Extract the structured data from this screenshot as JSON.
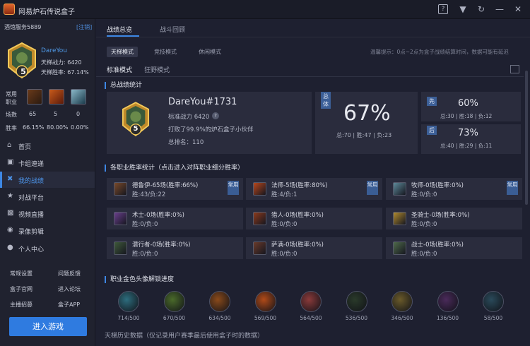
{
  "app": {
    "title": "网易炉石传说盒子"
  },
  "sidebar": {
    "server": "酒馆服务5889",
    "logout": "[注销]",
    "level": "5",
    "username": "DareYou",
    "ladder_power": "天梯战力: 6420",
    "ladder_winrate": "天梯胜率: 67.14%",
    "common_class_label": "常用职业",
    "stats": {
      "games_label": "场数",
      "games": [
        "65",
        "5",
        "0"
      ],
      "winrate_label": "胜率",
      "winrates": [
        "66.15%",
        "80.00%",
        "0.00%"
      ]
    },
    "nav": [
      {
        "icon": "home-icon",
        "label": "首页"
      },
      {
        "icon": "deck-icon",
        "label": "卡组速递"
      },
      {
        "icon": "swords-icon",
        "label": "我的战绩"
      },
      {
        "icon": "trophy-icon",
        "label": "对战平台"
      },
      {
        "icon": "tv-icon",
        "label": "视频直播"
      },
      {
        "icon": "film-icon",
        "label": "录像剪辑"
      },
      {
        "icon": "user-icon",
        "label": "个人中心"
      }
    ],
    "links": [
      "常规设置",
      "问题反馈",
      "盒子官网",
      "进入论坛",
      "主播招募",
      "盒子APP"
    ],
    "enter_game": "进入游戏"
  },
  "tabs": [
    "战绩总览",
    "战斗回顾"
  ],
  "modes": [
    "天梯模式",
    "竞技模式",
    "休闲模式"
  ],
  "hint": "温馨提示：0点~2点为盒子战绩结算时间，数据可能有延迟",
  "subtabs": [
    "标准模式",
    "狂野模式"
  ],
  "summary": {
    "section_title": "总战绩统计",
    "player_name": "DareYou#1731",
    "power": "标准战力 6420",
    "help": "?",
    "beat": "打败了99.9%的炉石盒子小伙伴",
    "rank": "总排名：110",
    "overall_tag": "总体",
    "overall_rate": "67%",
    "overall_detail": "总:70  |  胜:47  |  负:23",
    "first": {
      "tag": "先",
      "rate": "60%",
      "detail": "总:30  |  胜:18  |  负:12"
    },
    "second": {
      "tag": "后",
      "rate": "73%",
      "detail": "总:40  |  胜:29  |  负:11"
    }
  },
  "classes_title": "各职业胜率统计（点击进入对阵职业细分胜率）",
  "classes": [
    {
      "name": "德鲁伊-65场(胜率:66%)",
      "detail": "胜:43/负:22",
      "common": "常用",
      "icon": "druid-icon",
      "color": "#7a4a2a"
    },
    {
      "name": "法师-5场(胜率:80%)",
      "detail": "胜:4/负:1",
      "common": "常用",
      "icon": "mage-icon",
      "color": "#b8471c"
    },
    {
      "name": "牧师-0场(胜率:0%)",
      "detail": "胜:0/负:0",
      "common": "常用",
      "icon": "priest-icon",
      "color": "#5e8a9a"
    },
    {
      "name": "术士-0场(胜率:0%)",
      "detail": "胜:0/负:0",
      "common": "",
      "icon": "warlock-icon",
      "color": "#6a3f8c"
    },
    {
      "name": "猎人-0场(胜率:0%)",
      "detail": "胜:0/负:0",
      "common": "",
      "icon": "hunter-icon",
      "color": "#8c3a1c"
    },
    {
      "name": "圣骑士-0场(胜率:0%)",
      "detail": "胜:0/负:0",
      "common": "",
      "icon": "paladin-icon",
      "color": "#b08a2e"
    },
    {
      "name": "潜行者-0场(胜率:0%)",
      "detail": "胜:0/负:0",
      "common": "",
      "icon": "rogue-icon",
      "color": "#3f5a3a"
    },
    {
      "name": "萨满-0场(胜率:0%)",
      "detail": "胜:0/负:0",
      "common": "",
      "icon": "shaman-icon",
      "color": "#6a3a2a"
    },
    {
      "name": "战士-0场(胜率:0%)",
      "detail": "胜:0/负:0",
      "common": "",
      "icon": "warrior-icon",
      "color": "#4f6a4a"
    }
  ],
  "gold_title": "职业金色头像解锁进度",
  "gold": [
    {
      "progress": "714/500",
      "color": "#2d6d7e"
    },
    {
      "progress": "670/500",
      "color": "#4a6a2a"
    },
    {
      "progress": "634/500",
      "color": "#8a4a1a"
    },
    {
      "progress": "569/500",
      "color": "#b04a18"
    },
    {
      "progress": "564/500",
      "color": "#8a3a3a"
    },
    {
      "progress": "536/500",
      "color": "#2a3a2a"
    },
    {
      "progress": "346/500",
      "color": "#6a5a2a"
    },
    {
      "progress": "136/500",
      "color": "#4a2a5a"
    },
    {
      "progress": "58/500",
      "color": "#2a4a5a"
    }
  ],
  "history": "天梯历史数据（仅记录用户赛季最后使用盒子时的数据）"
}
